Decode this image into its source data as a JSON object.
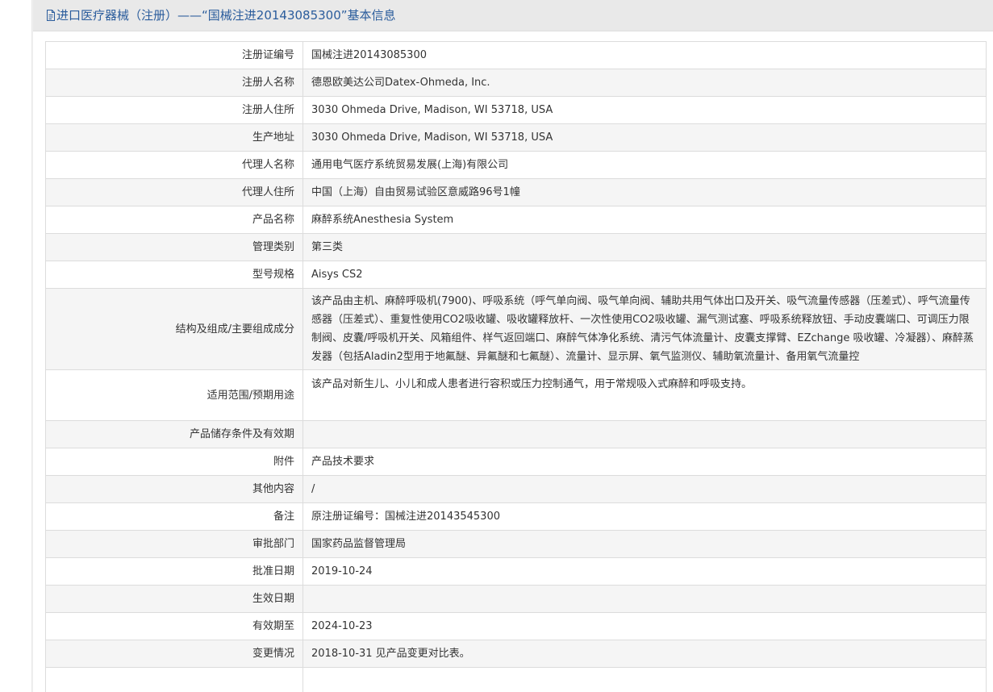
{
  "header": {
    "title": "进口医疗器械（注册）——“国械注进20143085300”基本信息",
    "icon": "document-icon",
    "title_color": "#2a5c9c"
  },
  "rows": [
    {
      "label": "注册证编号",
      "value": "国械注进20143085300"
    },
    {
      "label": "注册人名称",
      "value": "德恩欧美达公司Datex-Ohmeda, Inc."
    },
    {
      "label": "注册人住所",
      "value": "3030 Ohmeda Drive, Madison, WI 53718, USA"
    },
    {
      "label": "生产地址",
      "value": "3030 Ohmeda Drive, Madison, WI 53718, USA"
    },
    {
      "label": "代理人名称",
      "value": "通用电气医疗系统贸易发展(上海)有限公司"
    },
    {
      "label": "代理人住所",
      "value": "中国（上海）自由贸易试验区意威路96号1幢"
    },
    {
      "label": "产品名称",
      "value": "麻醉系统Anesthesia System"
    },
    {
      "label": "管理类别",
      "value": "第三类"
    },
    {
      "label": "型号规格",
      "value": "Aisys CS2"
    },
    {
      "label": "结构及组成/主要组成成分",
      "value": "该产品由主机、麻醉呼吸机(7900)、呼吸系统（呼气单向阀、吸气单向阀、辅助共用气体出口及开关、吸气流量传感器（压差式）、呼气流量传感器（压差式）、重复性使用CO2吸收罐、吸收罐释放杆、一次性使用CO2吸收罐、漏气测试塞、呼吸系统释放钮、手动皮囊端口、可调压力限制阀、皮囊/呼吸机开关、风箱组件、样气返回端口、麻醉气体净化系统、清污气体流量计、皮囊支撑臂、EZchange 吸收罐、冷凝器）、麻醉蒸发器（包括Aladin2型用于地氟醚、异氟醚和七氟醚）、流量计、显示屏、氧气监测仪、辅助氧流量计、备用氧气流量控"
    },
    {
      "label": "适用范围/预期用途",
      "value": "该产品对新生儿、小儿和成人患者进行容积或压力控制通气，用于常规吸入式麻醉和呼吸支持。"
    },
    {
      "label": "产品储存条件及有效期",
      "value": ""
    },
    {
      "label": "附件",
      "value": "产品技术要求"
    },
    {
      "label": "其他内容",
      "value": "/"
    },
    {
      "label": "备注",
      "value": "原注册证编号：国械注进20143545300"
    },
    {
      "label": "审批部门",
      "value": "国家药品监督管理局"
    },
    {
      "label": "批准日期",
      "value": "2019-10-24"
    },
    {
      "label": "生效日期",
      "value": ""
    },
    {
      "label": "有效期至",
      "value": "2024-10-23"
    },
    {
      "label": "变更情况",
      "value": "2018-10-31 见产品变更对比表。"
    },
    {
      "label": "",
      "value": ""
    }
  ]
}
